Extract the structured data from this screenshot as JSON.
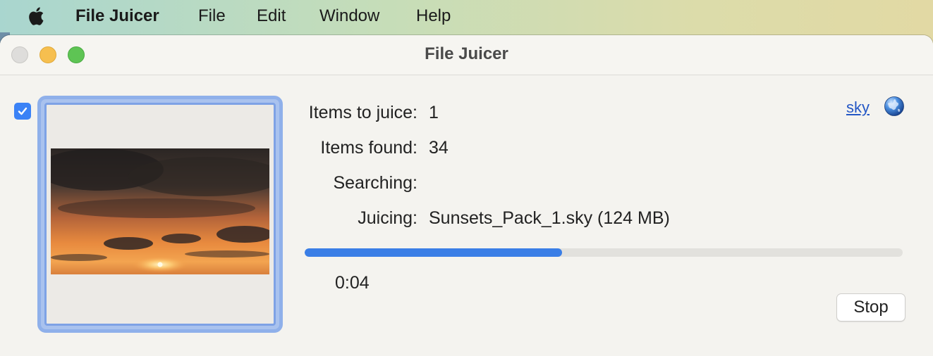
{
  "menubar": {
    "apple_icon": "apple-logo-icon",
    "app_name": "File Juicer",
    "items": [
      "File",
      "Edit",
      "Window",
      "Help"
    ]
  },
  "window": {
    "title": "File Juicer"
  },
  "thumbnail": {
    "checked": true,
    "description_icon": "sunset-sky-image"
  },
  "status": {
    "items_to_juice_label": "Items to juice:",
    "items_to_juice_value": "1",
    "items_found_label": "Items found:",
    "items_found_value": "34",
    "searching_label": "Searching:",
    "searching_value": "",
    "juicing_label": "Juicing:",
    "juicing_value": "Sunsets_Pack_1.sky (124 MB)"
  },
  "file_type": {
    "link_text": "sky",
    "icon": "globe-icon"
  },
  "progress": {
    "fraction": 0.43,
    "elapsed": "0:04"
  },
  "buttons": {
    "stop_label": "Stop"
  },
  "colors": {
    "accent": "#3a7ee6",
    "checkbox": "#3b82f6",
    "selection_border": "#8fb0ea",
    "link": "#2457c5"
  }
}
